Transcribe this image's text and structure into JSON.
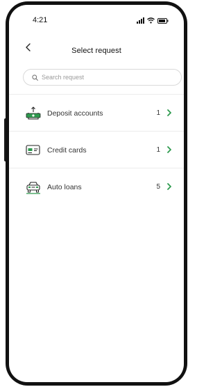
{
  "status_bar": {
    "time": "4:21"
  },
  "header": {
    "title": "Select request"
  },
  "search": {
    "placeholder": "Search request"
  },
  "requests": [
    {
      "label": "Deposit accounts",
      "count": "1",
      "icon": "deposit-icon"
    },
    {
      "label": "Credit cards",
      "count": "1",
      "icon": "credit-card-icon"
    },
    {
      "label": "Auto loans",
      "count": "5",
      "icon": "car-icon"
    }
  ],
  "colors": {
    "accent": "#2e9a4e",
    "text": "#333333",
    "divider": "#ececec"
  }
}
